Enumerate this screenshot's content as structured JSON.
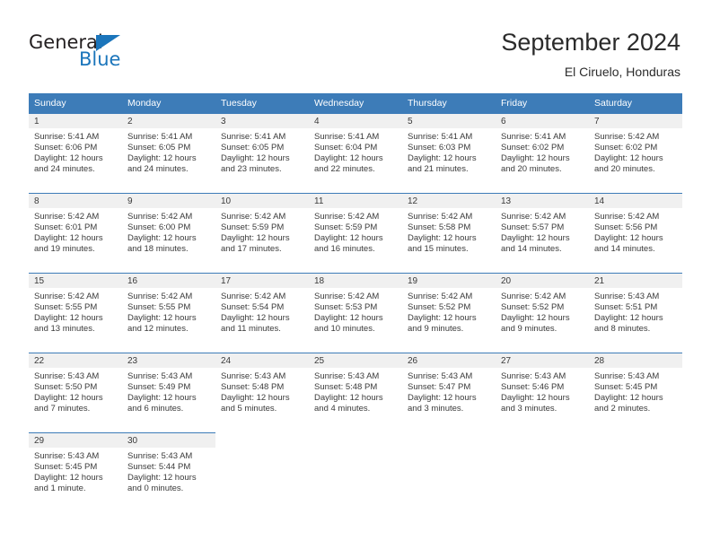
{
  "logo": {
    "word_general": "General",
    "word_blue": "Blue",
    "triangle_color": "#1b75bb"
  },
  "header": {
    "month_title": "September 2024",
    "location": "El Ciruelo, Honduras"
  },
  "theme": {
    "header_bg": "#3d7cb8",
    "daynum_bg": "#f0f0f0",
    "text": "#3a3a3a"
  },
  "weekday_headers": [
    "Sunday",
    "Monday",
    "Tuesday",
    "Wednesday",
    "Thursday",
    "Friday",
    "Saturday"
  ],
  "weeks": [
    [
      {
        "day": "1",
        "sunrise": "Sunrise: 5:41 AM",
        "sunset": "Sunset: 6:06 PM",
        "daylight1": "Daylight: 12 hours",
        "daylight2": "and 24 minutes."
      },
      {
        "day": "2",
        "sunrise": "Sunrise: 5:41 AM",
        "sunset": "Sunset: 6:05 PM",
        "daylight1": "Daylight: 12 hours",
        "daylight2": "and 24 minutes."
      },
      {
        "day": "3",
        "sunrise": "Sunrise: 5:41 AM",
        "sunset": "Sunset: 6:05 PM",
        "daylight1": "Daylight: 12 hours",
        "daylight2": "and 23 minutes."
      },
      {
        "day": "4",
        "sunrise": "Sunrise: 5:41 AM",
        "sunset": "Sunset: 6:04 PM",
        "daylight1": "Daylight: 12 hours",
        "daylight2": "and 22 minutes."
      },
      {
        "day": "5",
        "sunrise": "Sunrise: 5:41 AM",
        "sunset": "Sunset: 6:03 PM",
        "daylight1": "Daylight: 12 hours",
        "daylight2": "and 21 minutes."
      },
      {
        "day": "6",
        "sunrise": "Sunrise: 5:41 AM",
        "sunset": "Sunset: 6:02 PM",
        "daylight1": "Daylight: 12 hours",
        "daylight2": "and 20 minutes."
      },
      {
        "day": "7",
        "sunrise": "Sunrise: 5:42 AM",
        "sunset": "Sunset: 6:02 PM",
        "daylight1": "Daylight: 12 hours",
        "daylight2": "and 20 minutes."
      }
    ],
    [
      {
        "day": "8",
        "sunrise": "Sunrise: 5:42 AM",
        "sunset": "Sunset: 6:01 PM",
        "daylight1": "Daylight: 12 hours",
        "daylight2": "and 19 minutes."
      },
      {
        "day": "9",
        "sunrise": "Sunrise: 5:42 AM",
        "sunset": "Sunset: 6:00 PM",
        "daylight1": "Daylight: 12 hours",
        "daylight2": "and 18 minutes."
      },
      {
        "day": "10",
        "sunrise": "Sunrise: 5:42 AM",
        "sunset": "Sunset: 5:59 PM",
        "daylight1": "Daylight: 12 hours",
        "daylight2": "and 17 minutes."
      },
      {
        "day": "11",
        "sunrise": "Sunrise: 5:42 AM",
        "sunset": "Sunset: 5:59 PM",
        "daylight1": "Daylight: 12 hours",
        "daylight2": "and 16 minutes."
      },
      {
        "day": "12",
        "sunrise": "Sunrise: 5:42 AM",
        "sunset": "Sunset: 5:58 PM",
        "daylight1": "Daylight: 12 hours",
        "daylight2": "and 15 minutes."
      },
      {
        "day": "13",
        "sunrise": "Sunrise: 5:42 AM",
        "sunset": "Sunset: 5:57 PM",
        "daylight1": "Daylight: 12 hours",
        "daylight2": "and 14 minutes."
      },
      {
        "day": "14",
        "sunrise": "Sunrise: 5:42 AM",
        "sunset": "Sunset: 5:56 PM",
        "daylight1": "Daylight: 12 hours",
        "daylight2": "and 14 minutes."
      }
    ],
    [
      {
        "day": "15",
        "sunrise": "Sunrise: 5:42 AM",
        "sunset": "Sunset: 5:55 PM",
        "daylight1": "Daylight: 12 hours",
        "daylight2": "and 13 minutes."
      },
      {
        "day": "16",
        "sunrise": "Sunrise: 5:42 AM",
        "sunset": "Sunset: 5:55 PM",
        "daylight1": "Daylight: 12 hours",
        "daylight2": "and 12 minutes."
      },
      {
        "day": "17",
        "sunrise": "Sunrise: 5:42 AM",
        "sunset": "Sunset: 5:54 PM",
        "daylight1": "Daylight: 12 hours",
        "daylight2": "and 11 minutes."
      },
      {
        "day": "18",
        "sunrise": "Sunrise: 5:42 AM",
        "sunset": "Sunset: 5:53 PM",
        "daylight1": "Daylight: 12 hours",
        "daylight2": "and 10 minutes."
      },
      {
        "day": "19",
        "sunrise": "Sunrise: 5:42 AM",
        "sunset": "Sunset: 5:52 PM",
        "daylight1": "Daylight: 12 hours",
        "daylight2": "and 9 minutes."
      },
      {
        "day": "20",
        "sunrise": "Sunrise: 5:42 AM",
        "sunset": "Sunset: 5:52 PM",
        "daylight1": "Daylight: 12 hours",
        "daylight2": "and 9 minutes."
      },
      {
        "day": "21",
        "sunrise": "Sunrise: 5:43 AM",
        "sunset": "Sunset: 5:51 PM",
        "daylight1": "Daylight: 12 hours",
        "daylight2": "and 8 minutes."
      }
    ],
    [
      {
        "day": "22",
        "sunrise": "Sunrise: 5:43 AM",
        "sunset": "Sunset: 5:50 PM",
        "daylight1": "Daylight: 12 hours",
        "daylight2": "and 7 minutes."
      },
      {
        "day": "23",
        "sunrise": "Sunrise: 5:43 AM",
        "sunset": "Sunset: 5:49 PM",
        "daylight1": "Daylight: 12 hours",
        "daylight2": "and 6 minutes."
      },
      {
        "day": "24",
        "sunrise": "Sunrise: 5:43 AM",
        "sunset": "Sunset: 5:48 PM",
        "daylight1": "Daylight: 12 hours",
        "daylight2": "and 5 minutes."
      },
      {
        "day": "25",
        "sunrise": "Sunrise: 5:43 AM",
        "sunset": "Sunset: 5:48 PM",
        "daylight1": "Daylight: 12 hours",
        "daylight2": "and 4 minutes."
      },
      {
        "day": "26",
        "sunrise": "Sunrise: 5:43 AM",
        "sunset": "Sunset: 5:47 PM",
        "daylight1": "Daylight: 12 hours",
        "daylight2": "and 3 minutes."
      },
      {
        "day": "27",
        "sunrise": "Sunrise: 5:43 AM",
        "sunset": "Sunset: 5:46 PM",
        "daylight1": "Daylight: 12 hours",
        "daylight2": "and 3 minutes."
      },
      {
        "day": "28",
        "sunrise": "Sunrise: 5:43 AM",
        "sunset": "Sunset: 5:45 PM",
        "daylight1": "Daylight: 12 hours",
        "daylight2": "and 2 minutes."
      }
    ],
    [
      {
        "day": "29",
        "sunrise": "Sunrise: 5:43 AM",
        "sunset": "Sunset: 5:45 PM",
        "daylight1": "Daylight: 12 hours",
        "daylight2": "and 1 minute."
      },
      {
        "day": "30",
        "sunrise": "Sunrise: 5:43 AM",
        "sunset": "Sunset: 5:44 PM",
        "daylight1": "Daylight: 12 hours",
        "daylight2": "and 0 minutes."
      },
      null,
      null,
      null,
      null,
      null
    ]
  ]
}
